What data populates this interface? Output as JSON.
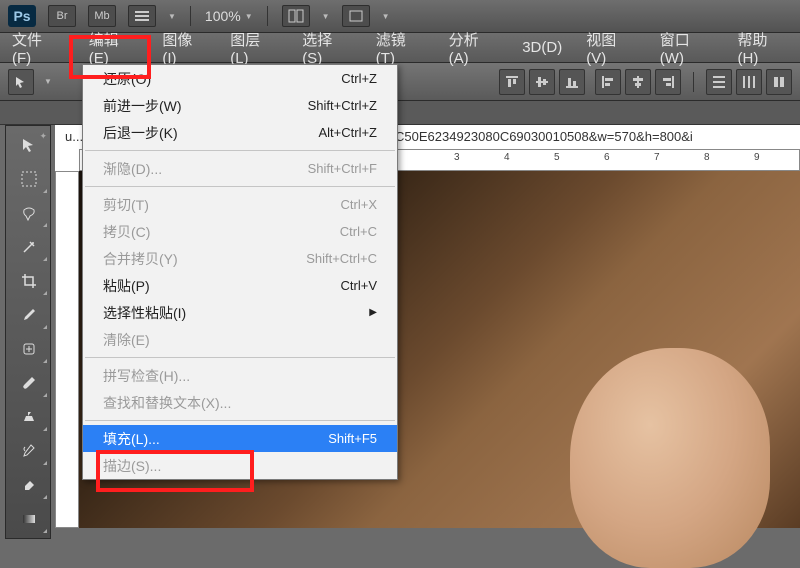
{
  "topbar": {
    "br": "Br",
    "mb": "Mb",
    "zoom": "100%"
  },
  "menubar": {
    "file": "文件(F)",
    "edit": "编辑(E)",
    "image": "图像(I)",
    "layer": "图层(L)",
    "select": "选择(S)",
    "filter": "滤镜(T)",
    "analysis": "分析(A)",
    "3d": "3D(D)",
    "view": "视图(V)",
    "window": "窗口(W)",
    "help": "帮助(H)"
  },
  "dropdown": {
    "undo": {
      "label": "还原(O)",
      "shortcut": "Ctrl+Z"
    },
    "forward": {
      "label": "前进一步(W)",
      "shortcut": "Shift+Ctrl+Z"
    },
    "back": {
      "label": "后退一步(K)",
      "shortcut": "Alt+Ctrl+Z"
    },
    "fade": {
      "label": "渐隐(D)...",
      "shortcut": "Shift+Ctrl+F"
    },
    "cut": {
      "label": "剪切(T)",
      "shortcut": "Ctrl+X"
    },
    "copy": {
      "label": "拷贝(C)",
      "shortcut": "Ctrl+C"
    },
    "copymerge": {
      "label": "合并拷贝(Y)",
      "shortcut": "Shift+Ctrl+C"
    },
    "paste": {
      "label": "粘贴(P)",
      "shortcut": "Ctrl+V"
    },
    "pastesp": {
      "label": "选择性粘贴(I)",
      "shortcut": ""
    },
    "clear": {
      "label": "清除(E)",
      "shortcut": ""
    },
    "spell": {
      "label": "拼写检查(H)...",
      "shortcut": ""
    },
    "findrepl": {
      "label": "查找和替换文本(X)...",
      "shortcut": ""
    },
    "fill": {
      "label": "填充(L)...",
      "shortcut": "Shift+F5"
    },
    "stroke": {
      "label": "描边(S)...",
      "shortcut": ""
    }
  },
  "doc": {
    "filename": "u...",
    "fileoverflow": "C50E6234923080C69030010508&w=570&h=800&i",
    "ruler": {
      "r3": "3",
      "r4": "4",
      "r5": "5",
      "r6": "6",
      "r7": "7",
      "r8": "8",
      "r9": "9"
    }
  }
}
